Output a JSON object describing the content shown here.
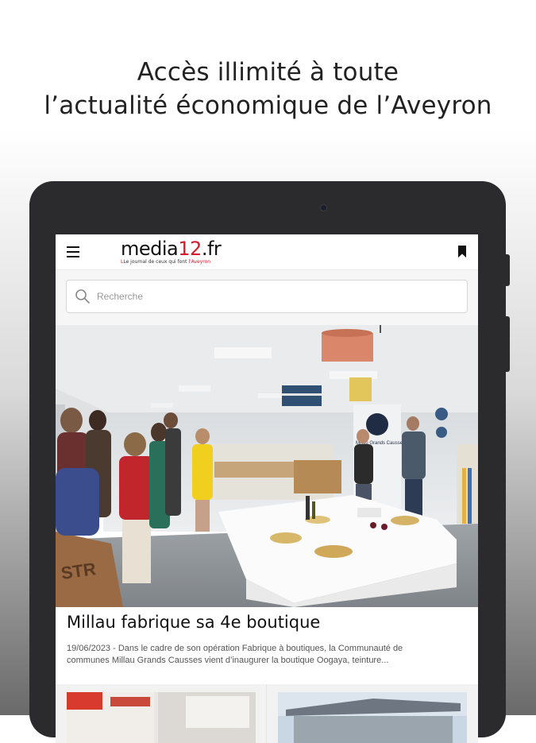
{
  "promo": {
    "line1": "Accès illimité à toute",
    "line2": "l’actualité économique de l’Aveyron"
  },
  "app": {
    "logo_prefix": "media",
    "logo_accent": "12",
    "logo_suffix": ".fr",
    "tagline_pre": "Le journal de ceux qui font ",
    "tagline_accent": "l'Aveyron",
    "brand_color": "#d7192b",
    "menu_icon": "hamburger-icon",
    "bookmark_icon": "bookmark-icon"
  },
  "search": {
    "placeholder": "Recherche",
    "icon": "search-icon"
  },
  "featured_article": {
    "title": "Millau fabrique sa 4e boutique",
    "date": "19/06/2023",
    "excerpt_line1": " - Dans le cadre de son opération Fabrique à boutiques, la Communauté de",
    "excerpt_line2": "communes Millau Grands Causses vient d’inaugurer la boutique Oogaya, teinture...",
    "image_banner_text": "Millau Grands Causses"
  }
}
